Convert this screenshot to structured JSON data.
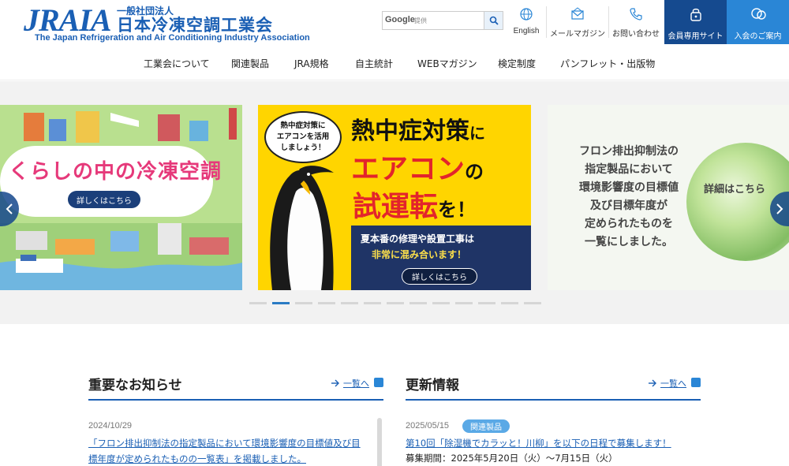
{
  "header": {
    "logo_main": "JRAIA",
    "logo_corp": "一般社団法人",
    "logo_jp": "日本冷凍空調工業会",
    "logo_en": "The Japan Refrigeration and Air Conditioning Industry Association",
    "search": {
      "brand": "Google",
      "hint": "提供",
      "placeholder": ""
    },
    "utility": [
      {
        "label": "English",
        "icon": "globe-icon"
      },
      {
        "label": "メールマガジン",
        "icon": "mail-icon"
      },
      {
        "label": "お問い合わせ",
        "icon": "phone-icon"
      }
    ],
    "member_label": "会員専用サイト",
    "join_label": "入会のご案内"
  },
  "nav": [
    "工業会について",
    "関連製品",
    "JRA規格",
    "自主統計",
    "WEBマガジン",
    "検定制度",
    "パンフレット・出版物"
  ],
  "slider": {
    "slide1": {
      "title": "くらしの中の冷凍空調",
      "button": "詳しくはこちら"
    },
    "slide2": {
      "bubble": "熱中症対策に\nエアコンを活用\nしましょう！",
      "title1": "熱中症対策",
      "title1_suffix": "に",
      "title2": "エアコン",
      "title2_suffix": "の",
      "title3": "試運転",
      "title3_suffix": "を！",
      "line1": "夏本番の修理や設置工事は",
      "line2": "非常に混み合います！",
      "button": "詳しくはこちら"
    },
    "slide3": {
      "text": "フロン排出抑制法の\n指定製品において\n環境影響度の目標値\n及び目標年度が\n定められたものを\n一覧にしました。",
      "link": "詳細はこちら"
    },
    "dot_count": 13,
    "active_dot": 1
  },
  "news": {
    "important": {
      "title": "重要なお知らせ",
      "more": "一覧へ",
      "date": "2024/10/29",
      "link": "「フロン排出抑制法の指定製品において環境影響度の目標値及び目標年度が定められたものの一覧表」を掲載しました。"
    },
    "updates": {
      "title": "更新情報",
      "more": "一覧へ",
      "date": "2025/05/15",
      "badge": "関連製品",
      "link": "第10回「除湿機でカラッと！川柳」を以下の日程で募集します！",
      "sub": "募集期間：2025年5月20日（火）～7月15日（火）"
    }
  },
  "colors": {
    "brand": "#1a5fb4",
    "member_btn": "#154a8f",
    "join_btn": "#2a86d6",
    "dot_active": "#2a7bc4"
  }
}
